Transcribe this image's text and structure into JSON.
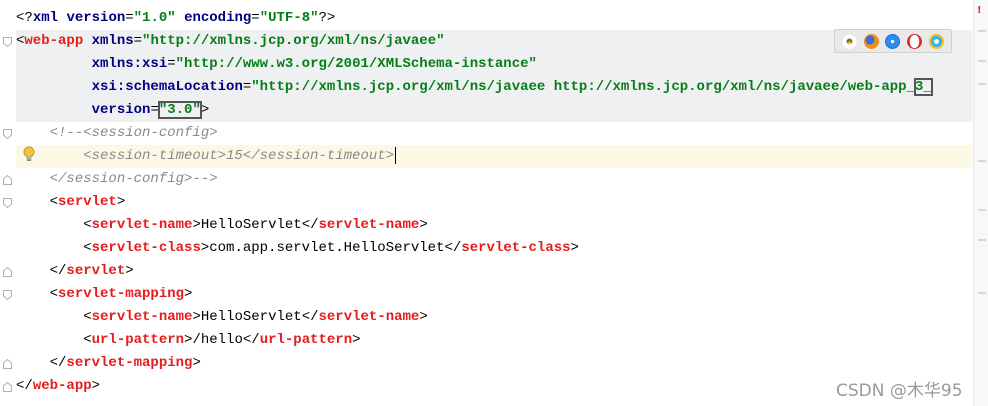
{
  "lines": [
    {
      "style": "plain",
      "tokens": [
        {
          "t": "<?",
          "c": "d"
        },
        {
          "t": "xml",
          "c": "kw"
        },
        {
          "t": " ",
          "c": "d"
        },
        {
          "t": "version",
          "c": "kw"
        },
        {
          "t": "=",
          "c": "d"
        },
        {
          "t": "\"1.0\"",
          "c": "str"
        },
        {
          "t": " ",
          "c": "d"
        },
        {
          "t": "encoding",
          "c": "kw"
        },
        {
          "t": "=",
          "c": "d"
        },
        {
          "t": "\"UTF-8\"",
          "c": "str"
        },
        {
          "t": "?>",
          "c": "d"
        }
      ]
    },
    {
      "style": "root",
      "tokens": [
        {
          "t": "<",
          "c": "d"
        },
        {
          "t": "web-app",
          "c": "tag"
        },
        {
          "t": " ",
          "c": "d"
        },
        {
          "t": "xmlns",
          "c": "kw"
        },
        {
          "t": "=",
          "c": "d"
        },
        {
          "t": "\"http://xmlns.jcp.org/xml/ns/javaee\"",
          "c": "str"
        }
      ]
    },
    {
      "style": "root",
      "tokens": [
        {
          "t": "         ",
          "c": "d"
        },
        {
          "t": "xmlns:xsi",
          "c": "kw"
        },
        {
          "t": "=",
          "c": "d"
        },
        {
          "t": "\"http://www.w3.org/2001/XMLSchema-instance\"",
          "c": "str"
        }
      ]
    },
    {
      "style": "root",
      "tokens": [
        {
          "t": "         ",
          "c": "d"
        },
        {
          "t": "xsi:schemaLocation",
          "c": "kw"
        },
        {
          "t": "=",
          "c": "d"
        },
        {
          "t": "\"http://xmlns.jcp.org/xml/ns/javaee http://xmlns.jcp.org/xml/ns/javaee/web-app_",
          "c": "str"
        },
        {
          "t": "3_",
          "c": "str",
          "box": true
        }
      ]
    },
    {
      "style": "root",
      "tokens": [
        {
          "t": "         ",
          "c": "d"
        },
        {
          "t": "version",
          "c": "kw"
        },
        {
          "t": "=",
          "c": "d"
        },
        {
          "t": "\"3.0\"",
          "c": "str",
          "box": true
        },
        {
          "t": ">",
          "c": "d"
        }
      ]
    },
    {
      "style": "plain",
      "tokens": [
        {
          "t": "    <!--<session-config>",
          "c": "com"
        }
      ]
    },
    {
      "style": "current",
      "caret": true,
      "tokens": [
        {
          "t": "        <session-timeout>15</session-timeout>",
          "c": "com"
        }
      ]
    },
    {
      "style": "plain",
      "tokens": [
        {
          "t": "    </session-config>-->",
          "c": "com"
        }
      ]
    },
    {
      "style": "plain",
      "tokens": [
        {
          "t": "    <",
          "c": "d"
        },
        {
          "t": "servlet",
          "c": "tag"
        },
        {
          "t": ">",
          "c": "d"
        }
      ]
    },
    {
      "style": "plain",
      "tokens": [
        {
          "t": "        <",
          "c": "d"
        },
        {
          "t": "servlet-name",
          "c": "tag"
        },
        {
          "t": ">",
          "c": "d"
        },
        {
          "t": "HelloServlet",
          "c": "txt"
        },
        {
          "t": "</",
          "c": "d"
        },
        {
          "t": "servlet-name",
          "c": "tag"
        },
        {
          "t": ">",
          "c": "d"
        }
      ]
    },
    {
      "style": "plain",
      "tokens": [
        {
          "t": "        <",
          "c": "d"
        },
        {
          "t": "servlet-class",
          "c": "tag"
        },
        {
          "t": ">",
          "c": "d"
        },
        {
          "t": "com.app.servlet.HelloServlet",
          "c": "txt"
        },
        {
          "t": "</",
          "c": "d"
        },
        {
          "t": "servlet-class",
          "c": "tag"
        },
        {
          "t": ">",
          "c": "d"
        }
      ]
    },
    {
      "style": "plain",
      "tokens": [
        {
          "t": "    </",
          "c": "d"
        },
        {
          "t": "servlet",
          "c": "tag"
        },
        {
          "t": ">",
          "c": "d"
        }
      ]
    },
    {
      "style": "plain",
      "tokens": [
        {
          "t": "    <",
          "c": "d"
        },
        {
          "t": "servlet-mapping",
          "c": "tag"
        },
        {
          "t": ">",
          "c": "d"
        }
      ]
    },
    {
      "style": "plain",
      "tokens": [
        {
          "t": "        <",
          "c": "d"
        },
        {
          "t": "servlet-name",
          "c": "tag"
        },
        {
          "t": ">",
          "c": "d"
        },
        {
          "t": "HelloServlet",
          "c": "txt"
        },
        {
          "t": "</",
          "c": "d"
        },
        {
          "t": "servlet-name",
          "c": "tag"
        },
        {
          "t": ">",
          "c": "d"
        }
      ]
    },
    {
      "style": "plain",
      "tokens": [
        {
          "t": "        <",
          "c": "d"
        },
        {
          "t": "url-pattern",
          "c": "tag"
        },
        {
          "t": ">",
          "c": "d"
        },
        {
          "t": "/hello",
          "c": "txt"
        },
        {
          "t": "</",
          "c": "d"
        },
        {
          "t": "url-pattern",
          "c": "tag"
        },
        {
          "t": ">",
          "c": "d"
        }
      ]
    },
    {
      "style": "plain",
      "tokens": [
        {
          "t": "    </",
          "c": "d"
        },
        {
          "t": "servlet-mapping",
          "c": "tag"
        },
        {
          "t": ">",
          "c": "d"
        }
      ]
    },
    {
      "style": "plain",
      "tokens": [
        {
          "t": "</",
          "c": "d"
        },
        {
          "t": "web-app",
          "c": "tag"
        },
        {
          "t": ">",
          "c": "d"
        }
      ]
    }
  ],
  "browser_icons": [
    "chrome-icon",
    "firefox-icon",
    "safari-icon",
    "opera-icon",
    "ie-icon"
  ],
  "error_marker": "!",
  "watermark": "CSDN @木华95",
  "colors": {
    "tag": "#e51c1c",
    "attribute": "#000080",
    "string": "#067d17",
    "comment": "#8a8a8a",
    "root_highlight": "#eff0f1",
    "current_line": "#fcf8e6"
  }
}
